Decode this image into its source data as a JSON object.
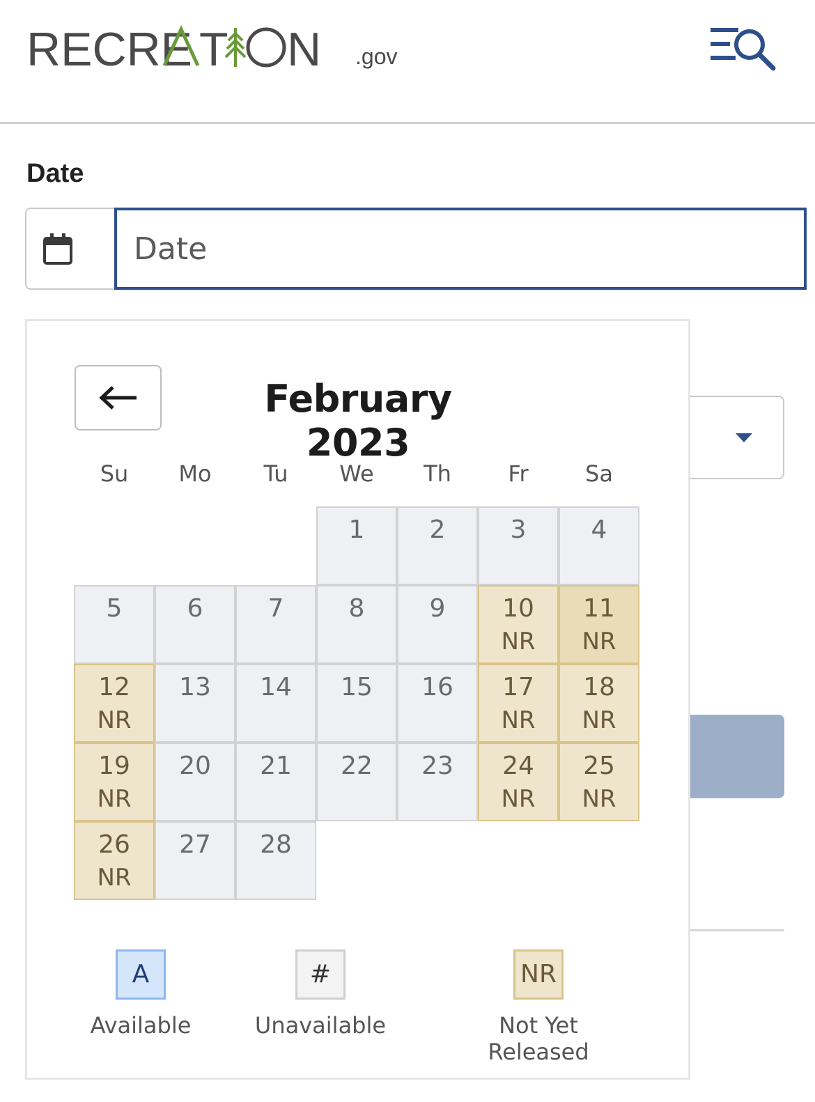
{
  "header": {
    "logo_text": "RECREATION",
    "logo_tld": ".gov",
    "menu_icon": "menu-search-icon"
  },
  "form": {
    "date_label": "Date",
    "date_placeholder": "Date",
    "calendar_icon": "calendar-icon"
  },
  "calendar": {
    "prev_icon": "arrow-left-icon",
    "month_title": "February 2023",
    "weekdays": [
      "Su",
      "Mo",
      "Tu",
      "We",
      "Th",
      "Fr",
      "Sa"
    ],
    "days": [
      {
        "day": "1",
        "status": ""
      },
      {
        "day": "2",
        "status": ""
      },
      {
        "day": "3",
        "status": ""
      },
      {
        "day": "4",
        "status": ""
      },
      {
        "day": "5",
        "status": ""
      },
      {
        "day": "6",
        "status": ""
      },
      {
        "day": "7",
        "status": ""
      },
      {
        "day": "8",
        "status": ""
      },
      {
        "day": "9",
        "status": ""
      },
      {
        "day": "10",
        "status": "NR"
      },
      {
        "day": "11",
        "status": "NR"
      },
      {
        "day": "12",
        "status": "NR"
      },
      {
        "day": "13",
        "status": ""
      },
      {
        "day": "14",
        "status": ""
      },
      {
        "day": "15",
        "status": ""
      },
      {
        "day": "16",
        "status": ""
      },
      {
        "day": "17",
        "status": "NR"
      },
      {
        "day": "18",
        "status": "NR"
      },
      {
        "day": "19",
        "status": "NR"
      },
      {
        "day": "20",
        "status": ""
      },
      {
        "day": "21",
        "status": ""
      },
      {
        "day": "22",
        "status": ""
      },
      {
        "day": "23",
        "status": ""
      },
      {
        "day": "24",
        "status": "NR"
      },
      {
        "day": "25",
        "status": "NR"
      },
      {
        "day": "26",
        "status": "NR"
      },
      {
        "day": "27",
        "status": ""
      },
      {
        "day": "28",
        "status": ""
      }
    ],
    "legend": [
      {
        "symbol": "A",
        "label": "Available"
      },
      {
        "symbol": "#",
        "label": "Unavailable"
      },
      {
        "symbol": "NR",
        "label": "Not Yet Released"
      }
    ]
  },
  "colors": {
    "accent": "#2e4f8c",
    "logo_green": "#6a9a3a",
    "not_released_bg": "#efe5cc",
    "unavailable_bg": "#eff0f4",
    "available_bg": "#d6e6fa"
  }
}
